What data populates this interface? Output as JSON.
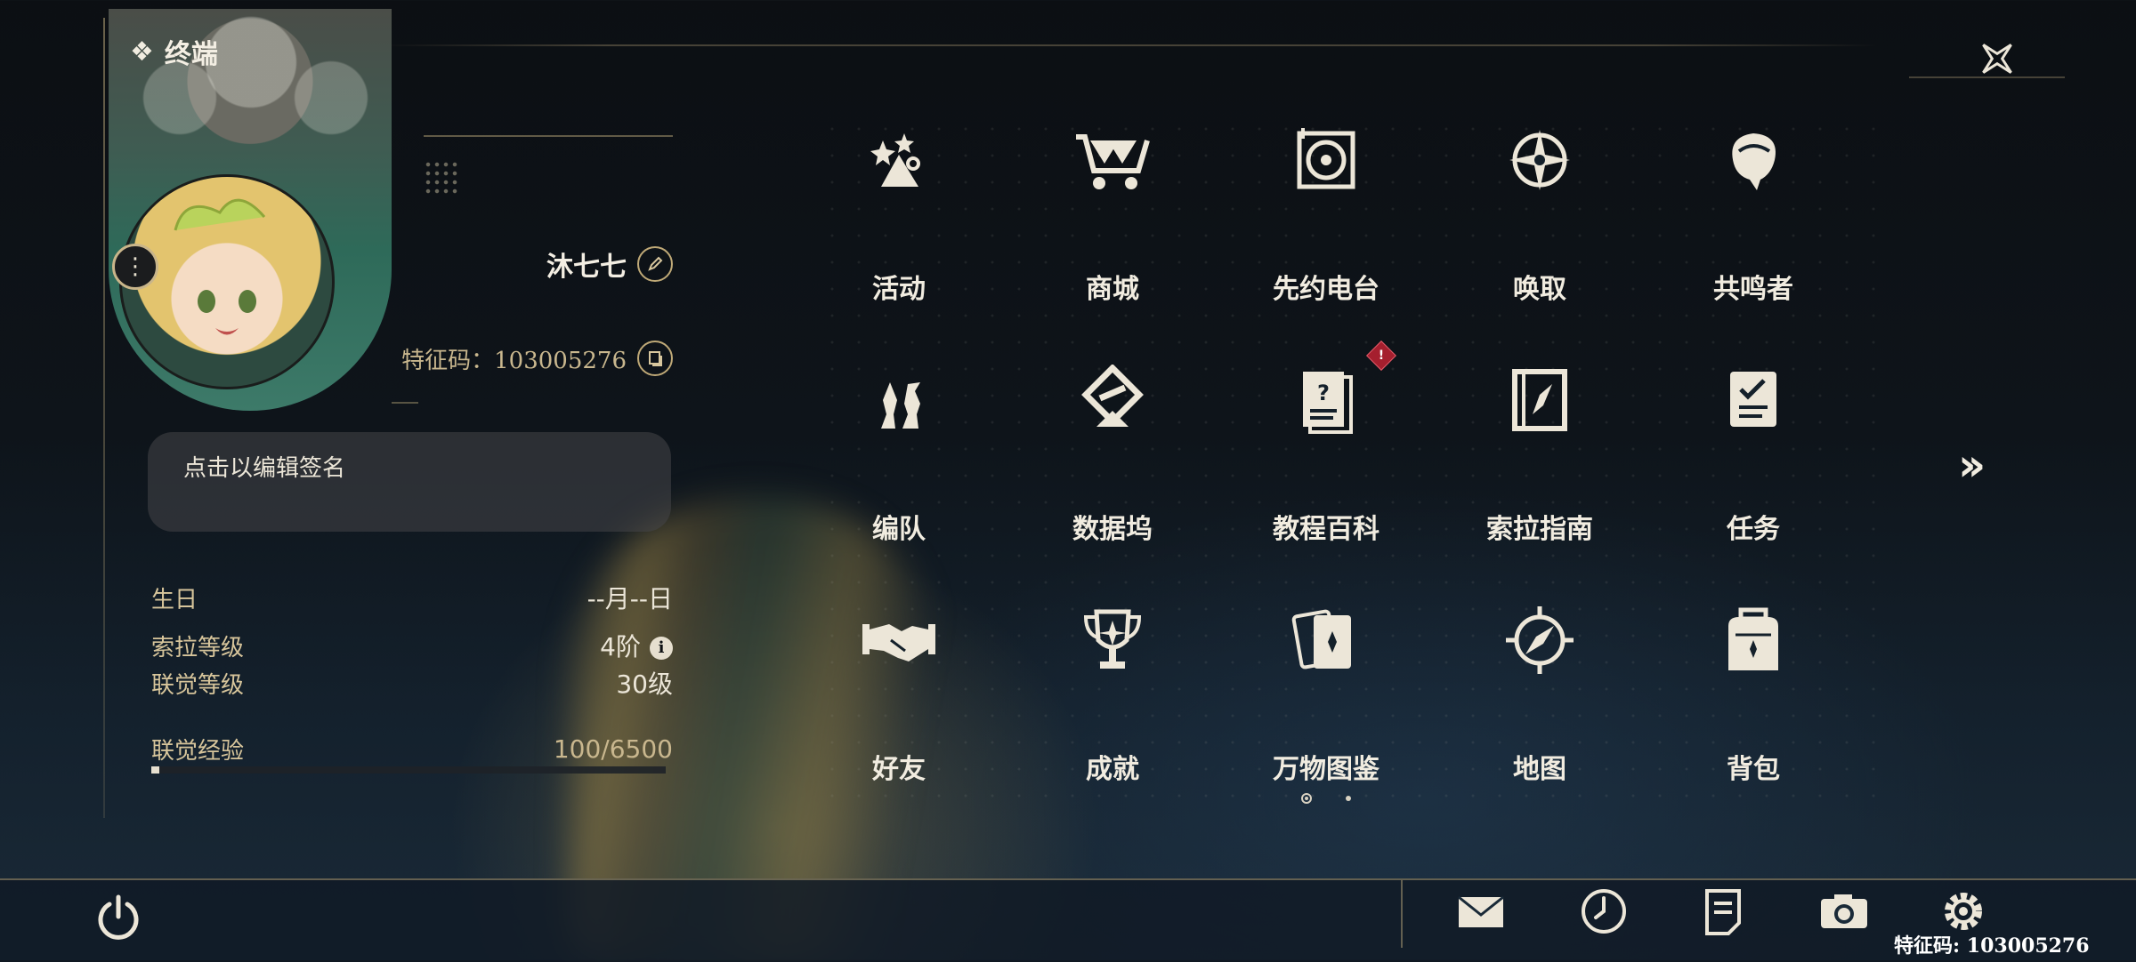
{
  "header": {
    "title": "终端",
    "title_icon": "diamond-cluster-icon",
    "close_icon": "close-star-icon"
  },
  "profile": {
    "name": "沐七七",
    "uid_label": "特征码：103005276",
    "signature_placeholder": "点击以编辑签名",
    "stats": {
      "birthday_label": "生日",
      "birthday_value": "--月--日",
      "sola_level_label": "索拉等级",
      "sola_level_value": "4阶",
      "union_level_label": "联觉等级",
      "union_level_value": "30级",
      "union_exp_label": "联觉经验",
      "union_exp_value": "100/6500",
      "union_exp_fraction": 0.0154
    }
  },
  "menu": {
    "items": [
      {
        "label": "活动",
        "icon": "activity-stars-icon"
      },
      {
        "label": "商城",
        "icon": "shop-cart-icon"
      },
      {
        "label": "先约电台",
        "icon": "radio-disc-icon"
      },
      {
        "label": "唤取",
        "icon": "convene-star-icon"
      },
      {
        "label": "共鸣者",
        "icon": "resonator-head-icon"
      },
      {
        "label": "编队",
        "icon": "team-chess-icon"
      },
      {
        "label": "数据坞",
        "icon": "data-bank-icon"
      },
      {
        "label": "教程百科",
        "icon": "tutorial-book-icon"
      },
      {
        "label": "索拉指南",
        "icon": "guide-book-icon"
      },
      {
        "label": "任务",
        "icon": "quest-clipboard-icon"
      },
      {
        "label": "好友",
        "icon": "friends-handshake-icon"
      },
      {
        "label": "成就",
        "icon": "achievement-trophy-icon"
      },
      {
        "label": "万物图鉴",
        "icon": "encyclopedia-cards-icon"
      },
      {
        "label": "地图",
        "icon": "map-compass-icon"
      },
      {
        "label": "背包",
        "icon": "backpack-icon"
      }
    ],
    "alert_on": "教程百科",
    "alert_glyph": "!"
  },
  "pagination": {
    "current": 1,
    "total": 2
  },
  "bottom_bar": {
    "icons": [
      "power-icon",
      "mail-icon",
      "clock-icon",
      "notice-icon",
      "camera-icon",
      "settings-gear-icon"
    ],
    "uid_overlay": "特征码: 103005276"
  },
  "colors": {
    "accent_gold": "#c9b78e",
    "text_light": "#ece6d8",
    "alert_red": "#a51f2e"
  }
}
